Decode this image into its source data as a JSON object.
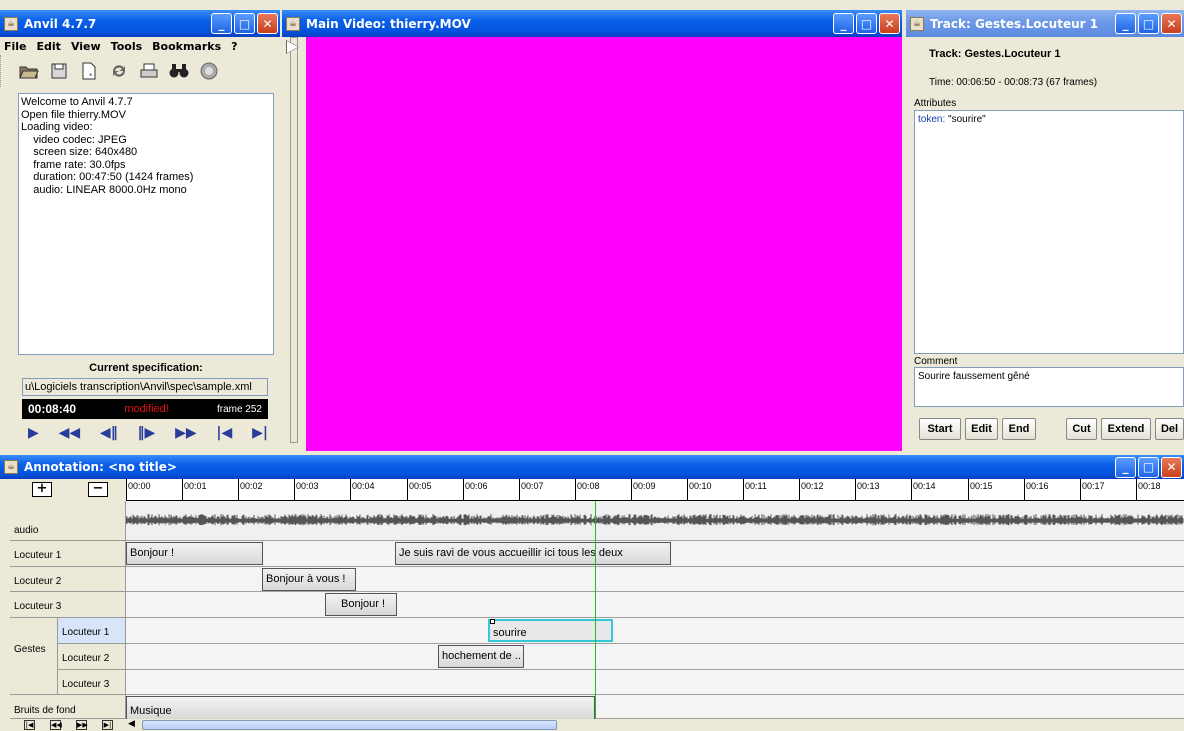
{
  "anvil_window": {
    "title": "Anvil 4.7.7",
    "menu": [
      "File",
      "Edit",
      "View",
      "Tools",
      "Bookmarks",
      "?"
    ],
    "toolbar_icons": [
      "open-folder-icon",
      "save-icon",
      "new-file-icon",
      "refresh-icon",
      "print-icon",
      "binoculars-icon",
      "info-icon"
    ],
    "log_lines": [
      "Welcome to Anvil 4.7.7",
      "Open file thierry.MOV",
      "Loading video:",
      "    video codec: JPEG",
      "    screen size: 640x480",
      "    frame rate: 30.0fps",
      "    duration: 00:47:50 (1424 frames)",
      "    audio: LINEAR 8000.0Hz mono"
    ],
    "spec_title": "Current specification:",
    "spec_path": "u\\Logiciels transcription\\Anvil\\spec\\sample.xml",
    "time": "00:08:40",
    "modified": "modified!",
    "frame": "frame 252",
    "transport": [
      "▶",
      "◀◀",
      "◀‖",
      "‖▶",
      "▶▶",
      "|◀",
      "▶|"
    ]
  },
  "video_window": {
    "title": "Main Video: thierry.MOV",
    "color": "#ff00ff"
  },
  "track_window": {
    "title": "Track: Gestes.Locuteur 1",
    "heading": "Track: Gestes.Locuteur 1",
    "time_info": "Time: 00:06:50 - 00:08:73 (67 frames)",
    "attributes_label": "Attributes",
    "attr_key": "token:",
    "attr_value": "\"sourire\"",
    "comment_label": "Comment",
    "comment": "Sourire faussement gêné",
    "buttons": [
      "Start",
      "Edit",
      "End",
      "Cut",
      "Extend",
      "Del"
    ]
  },
  "annotation_window": {
    "title": "Annotation: <no title>",
    "plus": "+",
    "minus": "−",
    "ticks": [
      "00:00",
      "00:01",
      "00:02",
      "00:03",
      "00:04",
      "00:05",
      "00:06",
      "00:07",
      "00:08",
      "00:09",
      "00:10",
      "00:11",
      "00:12",
      "00:13",
      "00:14",
      "00:15",
      "00:16",
      "00:17",
      "00:18"
    ],
    "tracks": {
      "audio": "audio",
      "loc1": "Locuteur 1",
      "loc2": "Locuteur 2",
      "loc3": "Locuteur 3",
      "gestes": "Gestes",
      "g1": "Locuteur 1",
      "g2": "Locuteur 2",
      "g3": "Locuteur 3",
      "bruits": "Bruits de fond"
    },
    "elements": {
      "loc1_a": "Bonjour !",
      "loc1_b": "Je suis ravi de vous accueillir ici tous les deux",
      "loc2_a": "Bonjour à vous !",
      "loc3_a": "Bonjour !",
      "g1_a": "sourire",
      "g2_a": "hochement de ..",
      "bruits_a": "Musique"
    },
    "colors": {
      "playhead": "#22bb22",
      "selection": "#33c8d8"
    }
  }
}
